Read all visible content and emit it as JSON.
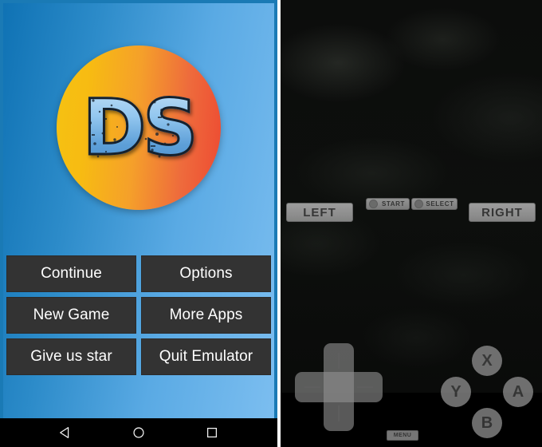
{
  "left_panel": {
    "name": "nds-emulator-main-menu",
    "logo": {
      "text": "DS",
      "circle_gradient_from": "#f6c212",
      "circle_gradient_to": "#ed4a32",
      "text_color": "#93c7ef",
      "outline_color": "#15212e"
    },
    "background": {
      "gradient_from": "#0f72b4",
      "gradient_to": "#7cbef0"
    },
    "menu_buttons": [
      {
        "label": "Continue",
        "name": "continue-button"
      },
      {
        "label": "Options",
        "name": "options-button"
      },
      {
        "label": "New Game",
        "name": "new-game-button"
      },
      {
        "label": "More Apps",
        "name": "more-apps-button"
      },
      {
        "label": "Give us star",
        "name": "give-us-star-button"
      },
      {
        "label": "Quit Emulator",
        "name": "quit-emulator-button"
      }
    ],
    "button_color": "#333333",
    "button_text_color": "#ffffff",
    "navbar": {
      "back": "back-triangle-icon",
      "home": "home-circle-icon",
      "recents": "recents-square-icon"
    }
  },
  "right_panel": {
    "name": "nds-emulator-gameplay-overlay",
    "screen_color": "#0c0d0c",
    "control_color": "#9a9a9a",
    "shoulder_buttons": [
      {
        "label": "LEFT",
        "name": "shoulder-left-button"
      },
      {
        "label": "RIGHT",
        "name": "shoulder-right-button"
      }
    ],
    "system_buttons": [
      {
        "label": "START",
        "name": "start-button"
      },
      {
        "label": "SELECT",
        "name": "select-button"
      }
    ],
    "face_buttons": [
      {
        "label": "X",
        "name": "x-button"
      },
      {
        "label": "Y",
        "name": "y-button"
      },
      {
        "label": "A",
        "name": "a-button"
      },
      {
        "label": "B",
        "name": "b-button"
      }
    ],
    "dpad": {
      "name": "dpad-control"
    },
    "menu_button": {
      "label": "MENU",
      "name": "menu-button"
    }
  }
}
